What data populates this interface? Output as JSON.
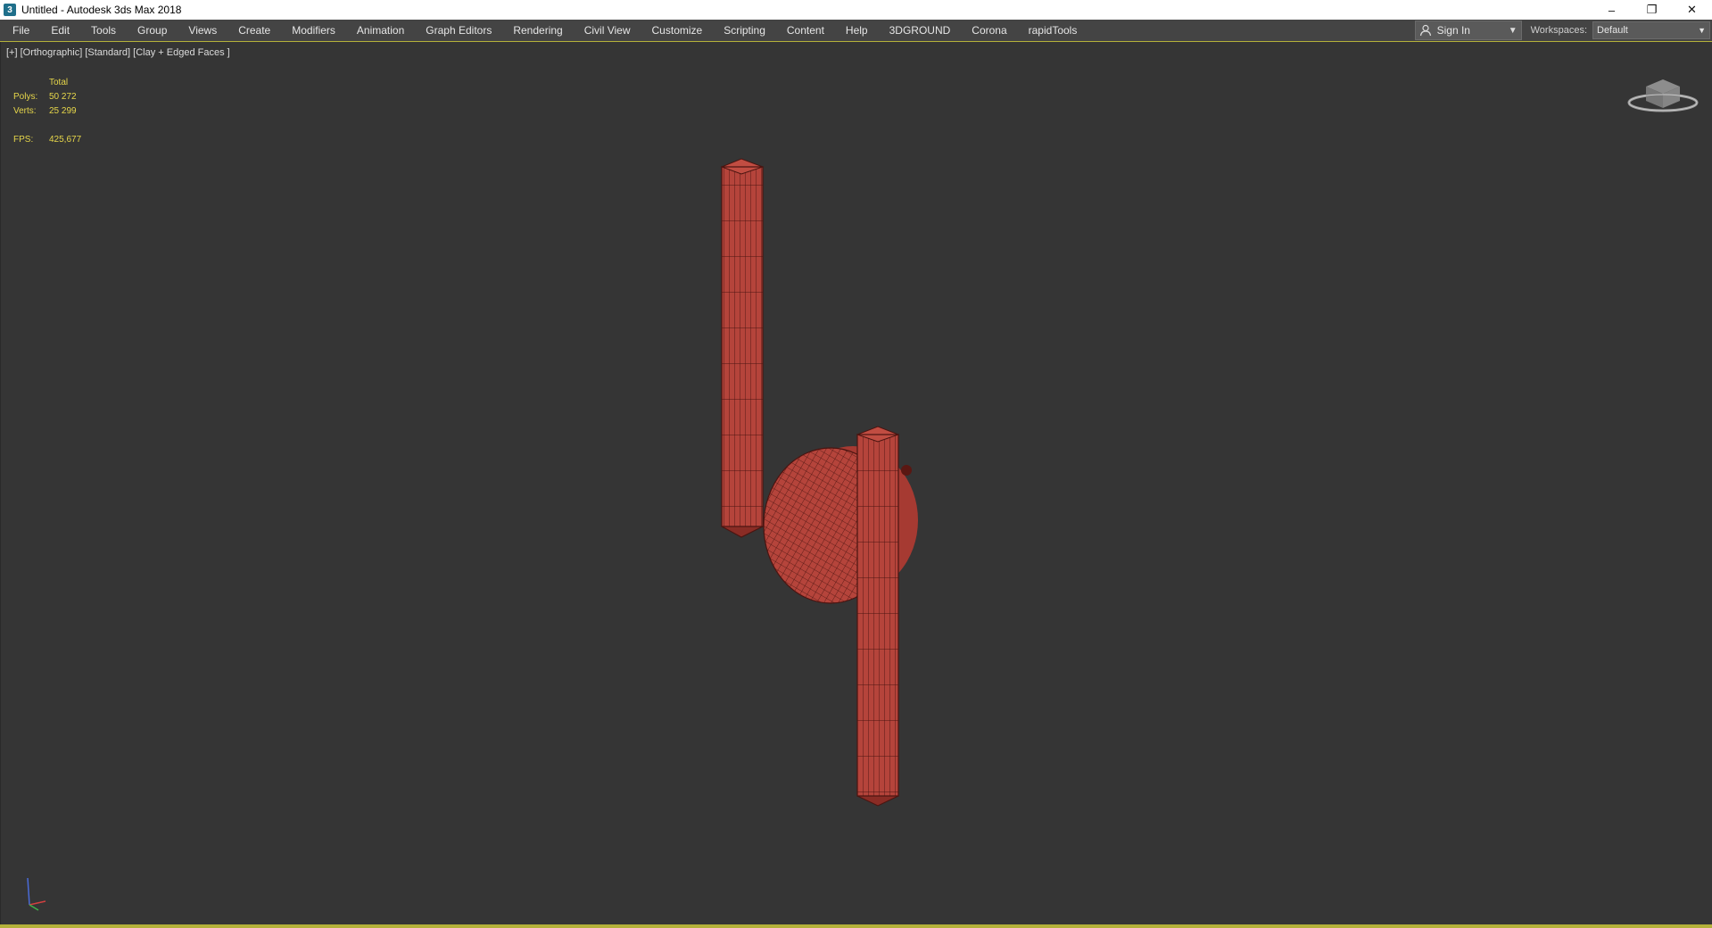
{
  "window": {
    "title": "Untitled - Autodesk 3ds Max 2018",
    "controls": {
      "minimize": "–",
      "restore": "❐",
      "close": "✕"
    }
  },
  "menubar": {
    "items": [
      "File",
      "Edit",
      "Tools",
      "Group",
      "Views",
      "Create",
      "Modifiers",
      "Animation",
      "Graph Editors",
      "Rendering",
      "Civil View",
      "Customize",
      "Scripting",
      "Content",
      "Help",
      "3DGROUND",
      "Corona",
      "rapidTools"
    ],
    "sign_in": "Sign In",
    "workspaces_label": "Workspaces:",
    "workspace_value": "Default"
  },
  "viewport": {
    "label": "[+] [Orthographic] [Standard] [Clay + Edged Faces ]",
    "stats": {
      "header": "Total",
      "polys_label": "Polys:",
      "polys_value": "50 272",
      "verts_label": "Verts:",
      "verts_value": "25 299",
      "fps_label": "FPS:",
      "fps_value": "425,677"
    }
  },
  "colors": {
    "viewport_bg": "#353535",
    "clay": "#b5443b",
    "wire": "#4a1410",
    "stats_text": "#e6d64a",
    "accent_border": "#b4b13a"
  },
  "icons": {
    "app": "3ds-max-icon",
    "user": "user-icon",
    "viewcube": "viewcube-icon",
    "axis": "axis-tripod-icon"
  }
}
